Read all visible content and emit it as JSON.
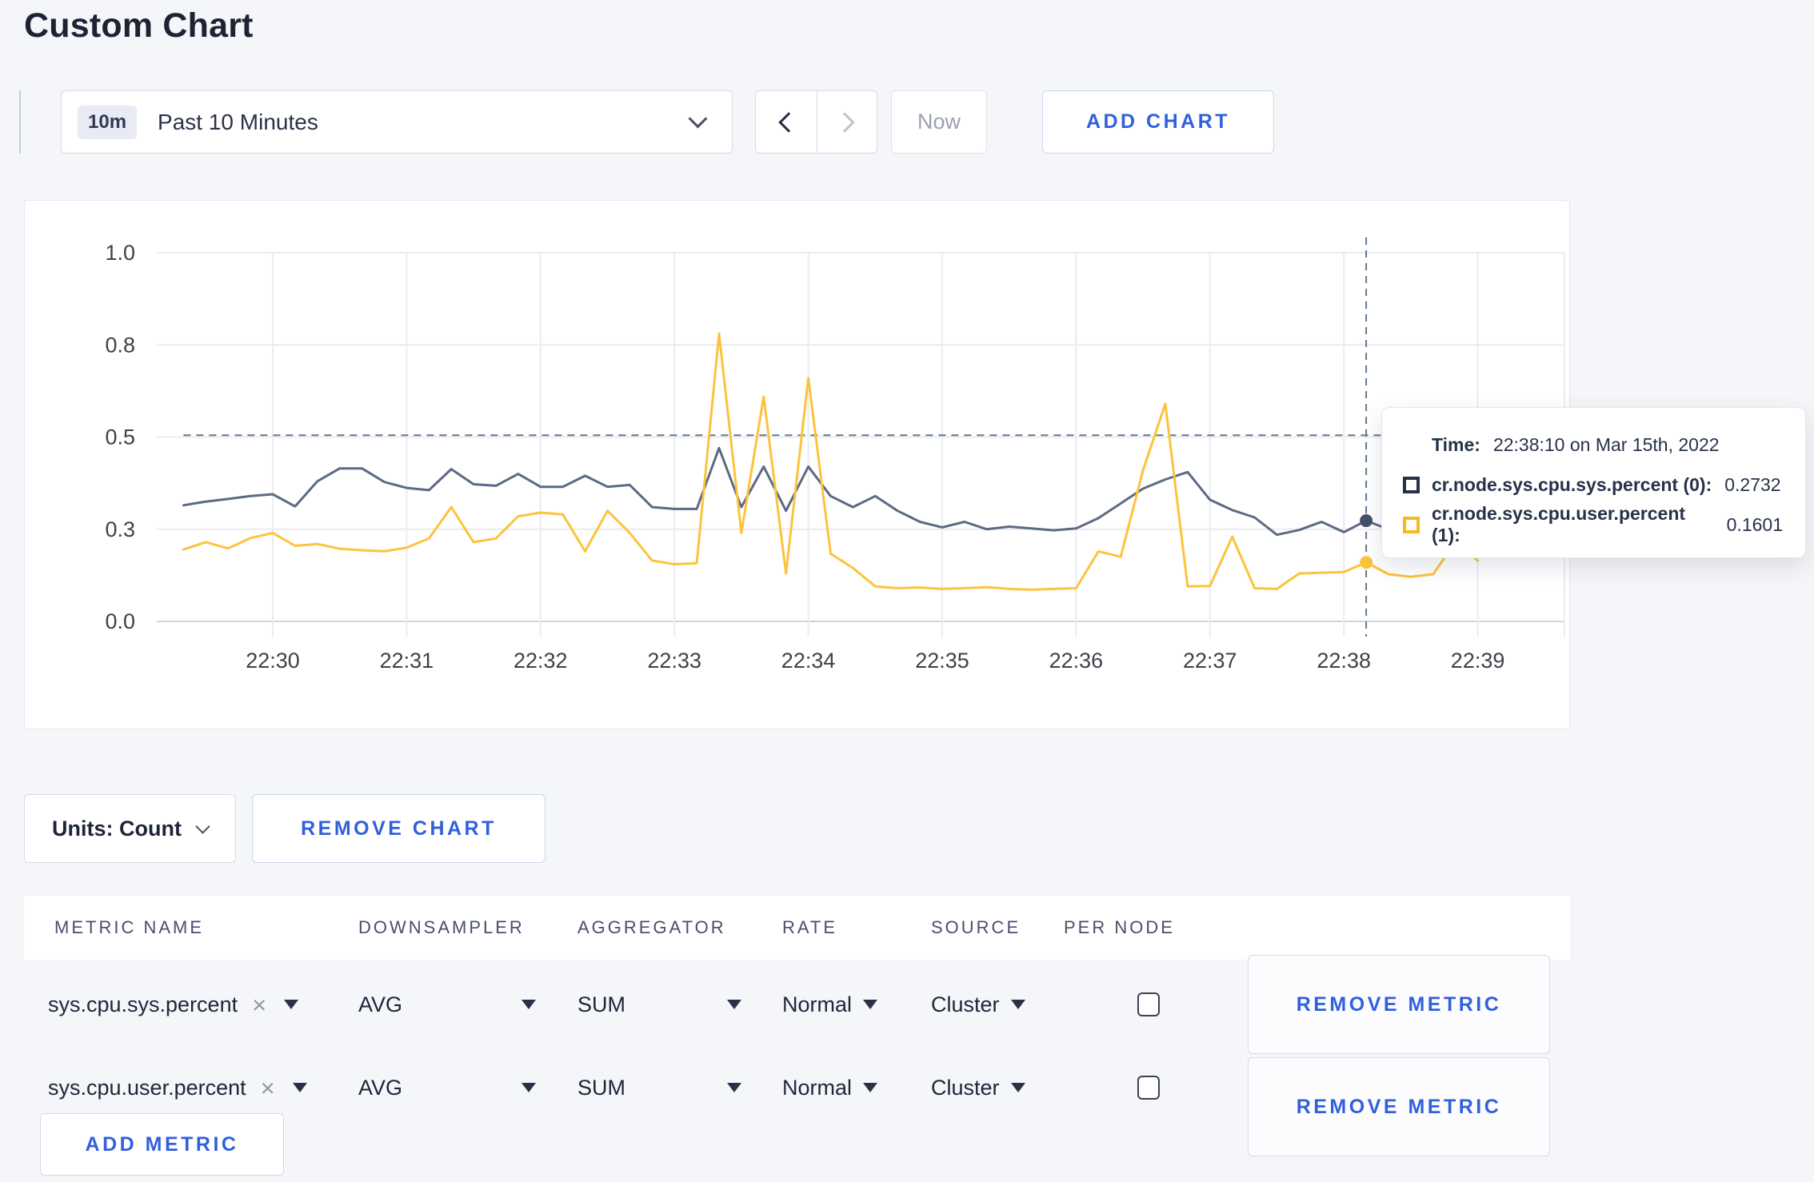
{
  "page": {
    "title": "Custom Chart"
  },
  "toolbar": {
    "time_range": {
      "badge": "10m",
      "label": "Past 10 Minutes"
    },
    "now_label": "Now",
    "add_chart_label": "ADD CHART"
  },
  "tooltip": {
    "time_label": "Time:",
    "time_value": "22:38:10 on Mar 15th, 2022",
    "series": [
      {
        "name": "cr.node.sys.cpu.sys.percent (0):",
        "value": "0.2732",
        "swatch_color": "#26324a"
      },
      {
        "name": "cr.node.sys.cpu.user.percent (1):",
        "value": "0.1601",
        "swatch_color": "#f5bb1c"
      }
    ]
  },
  "chart_footer": {
    "units_label": "Units: Count",
    "remove_chart_label": "REMOVE CHART"
  },
  "metrics_table": {
    "headers": [
      "METRIC NAME",
      "DOWNSAMPLER",
      "AGGREGATOR",
      "RATE",
      "SOURCE",
      "PER NODE"
    ],
    "rows": [
      {
        "metric_name": "sys.cpu.sys.percent",
        "downsampler": "AVG",
        "aggregator": "SUM",
        "rate": "Normal",
        "source": "Cluster",
        "per_node_checked": false,
        "remove_label": "REMOVE METRIC"
      },
      {
        "metric_name": "sys.cpu.user.percent",
        "downsampler": "AVG",
        "aggregator": "SUM",
        "rate": "Normal",
        "source": "Cluster",
        "per_node_checked": false,
        "remove_label": "REMOVE METRIC"
      }
    ],
    "add_metric_label": "ADD METRIC"
  },
  "chart_data": {
    "type": "line",
    "ylim": [
      0,
      1
    ],
    "grid": true,
    "y_ticks": [
      {
        "value": 0.0,
        "label": "0.0"
      },
      {
        "value": 0.25,
        "label": "0.3"
      },
      {
        "value": 0.5,
        "label": "0.5"
      },
      {
        "value": 0.75,
        "label": "0.8"
      },
      {
        "value": 1.0,
        "label": "1.0"
      }
    ],
    "x_tick_labels": [
      "22:30",
      "22:31",
      "22:32",
      "22:33",
      "22:34",
      "22:35",
      "22:36",
      "22:37",
      "22:38",
      "22:39"
    ],
    "start_seconds_from_2230": -40,
    "interval_seconds": 10,
    "series": [
      {
        "name": "cr.node.sys.cpu.sys.percent",
        "color": "#5c6a85",
        "start_time": "22:29:20",
        "values": [
          0.315,
          0.325,
          0.332,
          0.34,
          0.345,
          0.312,
          0.38,
          0.415,
          0.415,
          0.378,
          0.362,
          0.356,
          0.413,
          0.372,
          0.368,
          0.4,
          0.365,
          0.365,
          0.395,
          0.365,
          0.37,
          0.31,
          0.305,
          0.305,
          0.47,
          0.31,
          0.42,
          0.3,
          0.42,
          0.34,
          0.31,
          0.34,
          0.3,
          0.27,
          0.255,
          0.27,
          0.25,
          0.257,
          0.252,
          0.247,
          0.252,
          0.28,
          0.32,
          0.36,
          0.385,
          0.405,
          0.33,
          0.302,
          0.282,
          0.235,
          0.248,
          0.27,
          0.242,
          0.2732,
          0.25
        ]
      },
      {
        "name": "cr.node.sys.cpu.user.percent",
        "color": "#fcc33c",
        "start_time": "22:29:20",
        "values": [
          0.195,
          0.215,
          0.198,
          0.226,
          0.24,
          0.205,
          0.21,
          0.197,
          0.193,
          0.19,
          0.2,
          0.225,
          0.31,
          0.215,
          0.225,
          0.285,
          0.295,
          0.29,
          0.19,
          0.3,
          0.24,
          0.165,
          0.155,
          0.158,
          0.78,
          0.24,
          0.61,
          0.13,
          0.66,
          0.184,
          0.145,
          0.095,
          0.09,
          0.092,
          0.088,
          0.09,
          0.093,
          0.088,
          0.086,
          0.088,
          0.09,
          0.19,
          0.175,
          0.41,
          0.59,
          0.095,
          0.096,
          0.23,
          0.09,
          0.088,
          0.13,
          0.132,
          0.134,
          0.1601,
          0.128,
          0.121,
          0.128,
          0.215,
          0.165
        ]
      }
    ],
    "crosshair": {
      "time": "22:38:10",
      "seconds_from_2230": 490,
      "hline_value": 0.505,
      "dots": [
        {
          "value": 0.2732,
          "color": "#44506b"
        },
        {
          "value": 0.1601,
          "color": "#fcc33c"
        }
      ]
    },
    "colors": {
      "grid": "#ebecf0",
      "axis": "#d2d4da",
      "tick_text": "#3e4248",
      "dashed": "#5d7890"
    }
  }
}
